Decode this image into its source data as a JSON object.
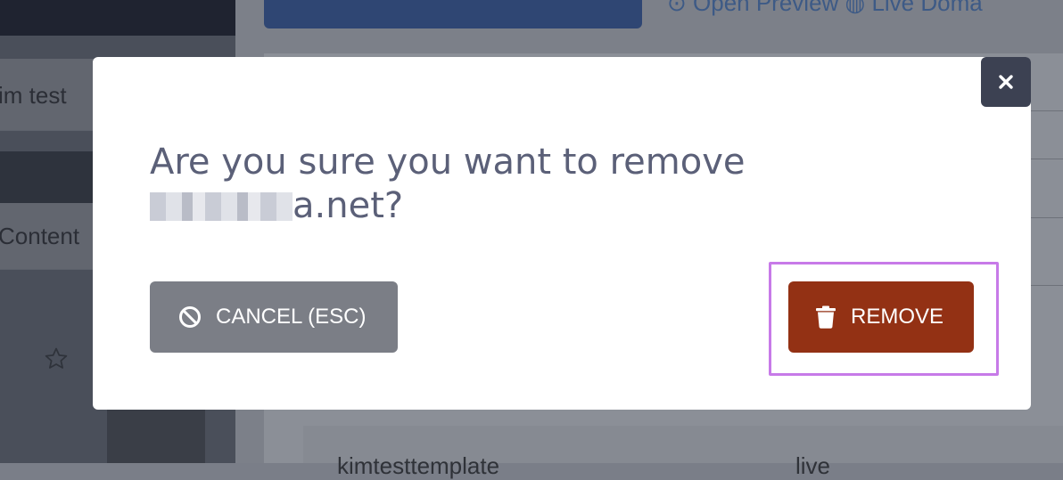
{
  "background": {
    "sidebar_item_1": "im test",
    "sidebar_item_2": "Content",
    "top_links": "⊙ Open Preview   ◍ Live Doma",
    "table_col_1": "kimtesttemplate",
    "table_col_2": "live"
  },
  "dialog": {
    "title_line1": "Are you sure you want to remove",
    "domain_suffix": "a.net?",
    "cancel_label": "CANCEL (ESC)",
    "remove_label": "REMOVE",
    "close_label": "×"
  },
  "icons": {
    "close": "close-icon",
    "cancel": "ban-icon",
    "remove": "trash-icon",
    "star": "star-icon"
  },
  "colors": {
    "remove_button": "#933114",
    "cancel_button": "#7b7e86",
    "close_button": "#3c4152",
    "highlight": "#c77ae8",
    "title_text": "#5b6078"
  }
}
